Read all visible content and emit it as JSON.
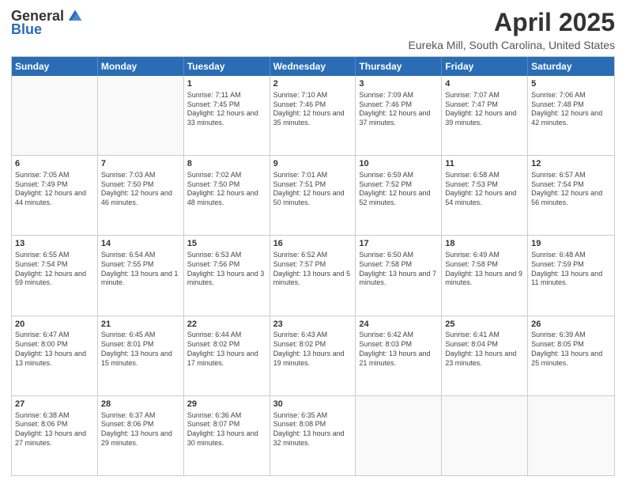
{
  "logo": {
    "general": "General",
    "blue": "Blue"
  },
  "header": {
    "title": "April 2025",
    "subtitle": "Eureka Mill, South Carolina, United States"
  },
  "weekdays": [
    "Sunday",
    "Monday",
    "Tuesday",
    "Wednesday",
    "Thursday",
    "Friday",
    "Saturday"
  ],
  "weeks": [
    [
      {
        "day": "",
        "info": ""
      },
      {
        "day": "",
        "info": ""
      },
      {
        "day": "1",
        "info": "Sunrise: 7:11 AM\nSunset: 7:45 PM\nDaylight: 12 hours and 33 minutes."
      },
      {
        "day": "2",
        "info": "Sunrise: 7:10 AM\nSunset: 7:46 PM\nDaylight: 12 hours and 35 minutes."
      },
      {
        "day": "3",
        "info": "Sunrise: 7:09 AM\nSunset: 7:46 PM\nDaylight: 12 hours and 37 minutes."
      },
      {
        "day": "4",
        "info": "Sunrise: 7:07 AM\nSunset: 7:47 PM\nDaylight: 12 hours and 39 minutes."
      },
      {
        "day": "5",
        "info": "Sunrise: 7:06 AM\nSunset: 7:48 PM\nDaylight: 12 hours and 42 minutes."
      }
    ],
    [
      {
        "day": "6",
        "info": "Sunrise: 7:05 AM\nSunset: 7:49 PM\nDaylight: 12 hours and 44 minutes."
      },
      {
        "day": "7",
        "info": "Sunrise: 7:03 AM\nSunset: 7:50 PM\nDaylight: 12 hours and 46 minutes."
      },
      {
        "day": "8",
        "info": "Sunrise: 7:02 AM\nSunset: 7:50 PM\nDaylight: 12 hours and 48 minutes."
      },
      {
        "day": "9",
        "info": "Sunrise: 7:01 AM\nSunset: 7:51 PM\nDaylight: 12 hours and 50 minutes."
      },
      {
        "day": "10",
        "info": "Sunrise: 6:59 AM\nSunset: 7:52 PM\nDaylight: 12 hours and 52 minutes."
      },
      {
        "day": "11",
        "info": "Sunrise: 6:58 AM\nSunset: 7:53 PM\nDaylight: 12 hours and 54 minutes."
      },
      {
        "day": "12",
        "info": "Sunrise: 6:57 AM\nSunset: 7:54 PM\nDaylight: 12 hours and 56 minutes."
      }
    ],
    [
      {
        "day": "13",
        "info": "Sunrise: 6:55 AM\nSunset: 7:54 PM\nDaylight: 12 hours and 59 minutes."
      },
      {
        "day": "14",
        "info": "Sunrise: 6:54 AM\nSunset: 7:55 PM\nDaylight: 13 hours and 1 minute."
      },
      {
        "day": "15",
        "info": "Sunrise: 6:53 AM\nSunset: 7:56 PM\nDaylight: 13 hours and 3 minutes."
      },
      {
        "day": "16",
        "info": "Sunrise: 6:52 AM\nSunset: 7:57 PM\nDaylight: 13 hours and 5 minutes."
      },
      {
        "day": "17",
        "info": "Sunrise: 6:50 AM\nSunset: 7:58 PM\nDaylight: 13 hours and 7 minutes."
      },
      {
        "day": "18",
        "info": "Sunrise: 6:49 AM\nSunset: 7:58 PM\nDaylight: 13 hours and 9 minutes."
      },
      {
        "day": "19",
        "info": "Sunrise: 6:48 AM\nSunset: 7:59 PM\nDaylight: 13 hours and 11 minutes."
      }
    ],
    [
      {
        "day": "20",
        "info": "Sunrise: 6:47 AM\nSunset: 8:00 PM\nDaylight: 13 hours and 13 minutes."
      },
      {
        "day": "21",
        "info": "Sunrise: 6:45 AM\nSunset: 8:01 PM\nDaylight: 13 hours and 15 minutes."
      },
      {
        "day": "22",
        "info": "Sunrise: 6:44 AM\nSunset: 8:02 PM\nDaylight: 13 hours and 17 minutes."
      },
      {
        "day": "23",
        "info": "Sunrise: 6:43 AM\nSunset: 8:02 PM\nDaylight: 13 hours and 19 minutes."
      },
      {
        "day": "24",
        "info": "Sunrise: 6:42 AM\nSunset: 8:03 PM\nDaylight: 13 hours and 21 minutes."
      },
      {
        "day": "25",
        "info": "Sunrise: 6:41 AM\nSunset: 8:04 PM\nDaylight: 13 hours and 23 minutes."
      },
      {
        "day": "26",
        "info": "Sunrise: 6:39 AM\nSunset: 8:05 PM\nDaylight: 13 hours and 25 minutes."
      }
    ],
    [
      {
        "day": "27",
        "info": "Sunrise: 6:38 AM\nSunset: 8:06 PM\nDaylight: 13 hours and 27 minutes."
      },
      {
        "day": "28",
        "info": "Sunrise: 6:37 AM\nSunset: 8:06 PM\nDaylight: 13 hours and 29 minutes."
      },
      {
        "day": "29",
        "info": "Sunrise: 6:36 AM\nSunset: 8:07 PM\nDaylight: 13 hours and 30 minutes."
      },
      {
        "day": "30",
        "info": "Sunrise: 6:35 AM\nSunset: 8:08 PM\nDaylight: 13 hours and 32 minutes."
      },
      {
        "day": "",
        "info": ""
      },
      {
        "day": "",
        "info": ""
      },
      {
        "day": "",
        "info": ""
      }
    ]
  ]
}
